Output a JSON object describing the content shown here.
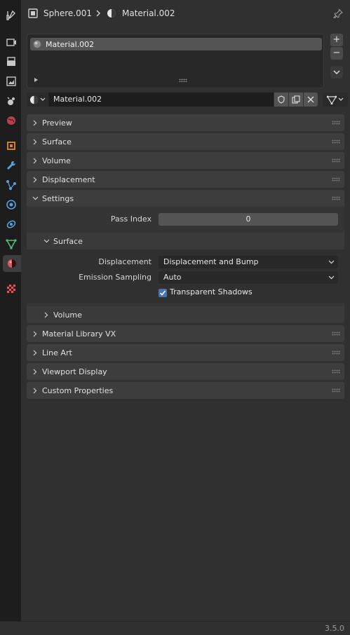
{
  "header": {
    "object_name": "Sphere.001",
    "material_name": "Material.002"
  },
  "slots": {
    "items": [
      {
        "label": "Material.002"
      }
    ]
  },
  "datablock": {
    "name": "Material.002"
  },
  "panels": {
    "preview": "Preview",
    "surface": "Surface",
    "volume": "Volume",
    "displacement": "Displacement",
    "settings": "Settings",
    "material_library": "Material Library VX",
    "line_art": "Line Art",
    "viewport_display": "Viewport Display",
    "custom_properties": "Custom Properties"
  },
  "settings": {
    "pass_index_label": "Pass Index",
    "pass_index_value": "0",
    "surface_sub": "Surface",
    "displacement_label": "Displacement",
    "displacement_value": "Displacement and Bump",
    "emission_label": "Emission Sampling",
    "emission_value": "Auto",
    "transparent_shadows_label": "Transparent Shadows",
    "transparent_shadows_checked": true,
    "volume_sub": "Volume"
  },
  "footer": {
    "version": "3.5.0"
  },
  "colors": {
    "accent_blue": "#4772b3",
    "active_tab_material": "#e0565a"
  }
}
